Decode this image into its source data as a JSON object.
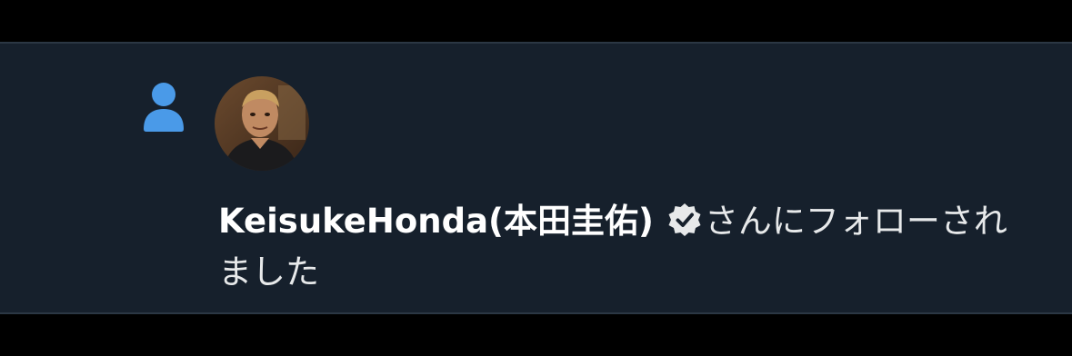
{
  "notification": {
    "type_icon": "person-icon",
    "avatar_icon": "user-avatar",
    "user_name": "KeisukeHonda(本田圭佑)",
    "verified_icon": "verified-badge-icon",
    "message": "さんにフォローされました"
  },
  "colors": {
    "page_background": "#000000",
    "card_background": "#16202c",
    "card_border": "#2b3744",
    "icon_blue": "#4a9ae8",
    "text_primary": "#e7e9ea",
    "name_text": "#ffffff"
  }
}
